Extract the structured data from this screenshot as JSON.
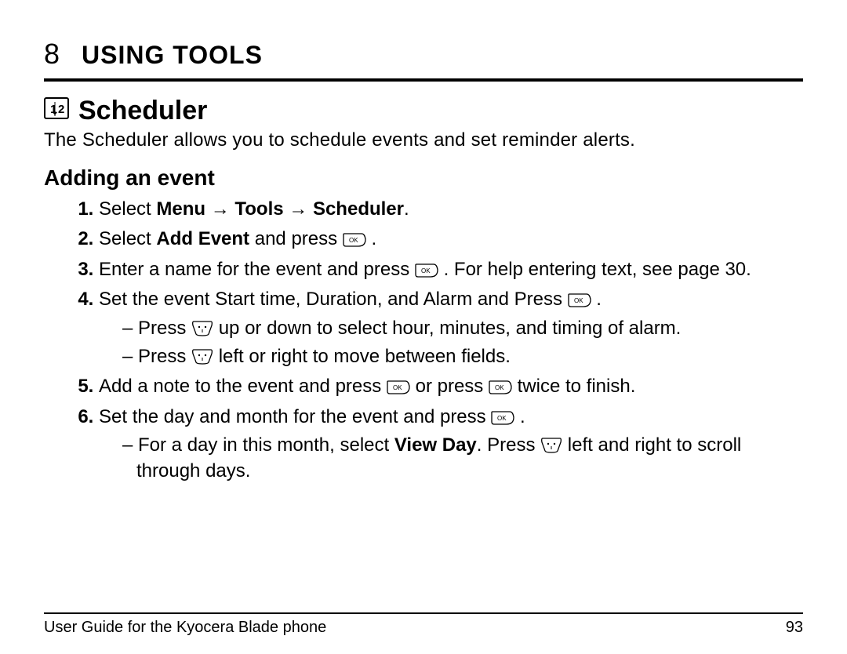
{
  "chapter": {
    "number": "8",
    "title": "USING TOOLS"
  },
  "section": {
    "title": "Scheduler",
    "description": "The Scheduler allows you to schedule events and set reminder alerts."
  },
  "subheading": "Adding an event",
  "steps": {
    "s1_a": "Select ",
    "s1_menu": "Menu",
    "s1_arrow": " → ",
    "s1_tools": "Tools",
    "s1_scheduler": "Scheduler",
    "s1_period": ".",
    "s2_a": "Select ",
    "s2_add": "Add Event",
    "s2_b": " and press ",
    "s2_c": " .",
    "s3_a": "Enter a name for the event and press ",
    "s3_b": " . For help entering text, see page 30.",
    "s4_a": "Set the event Start time, Duration, and Alarm and Press ",
    "s4_b": " .",
    "s4_sub1_a": "Press ",
    "s4_sub1_b": " up or down to select hour, minutes, and timing of alarm.",
    "s4_sub2_a": "Press ",
    "s4_sub2_b": " left or right to move between fields.",
    "s5_a": "Add a note to the event and press ",
    "s5_b": " or press ",
    "s5_c": " twice to finish.",
    "s6_a": "Set the day and month for the event and press ",
    "s6_b": " .",
    "s6_sub1_a": "For a day in this month, select ",
    "s6_sub1_view": "View Day",
    "s6_sub1_b": ". Press ",
    "s6_sub1_c": " left and right to scroll through days."
  },
  "footer": {
    "left": "User Guide for the Kyocera Blade phone",
    "right": "93"
  }
}
